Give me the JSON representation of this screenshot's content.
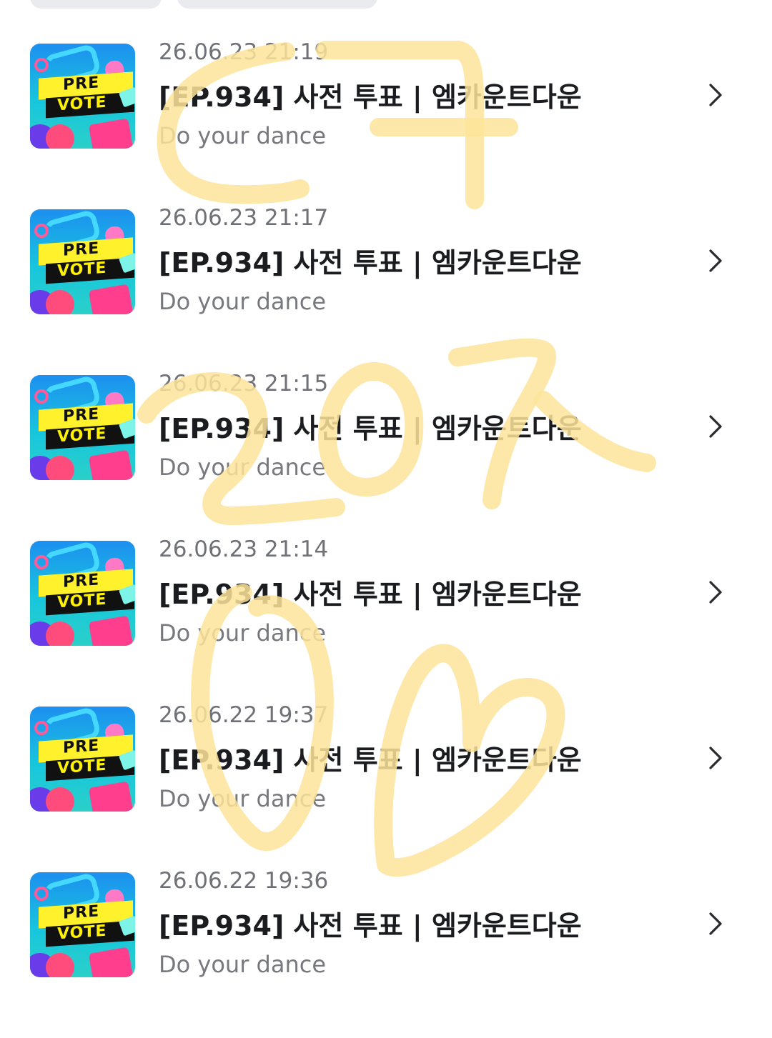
{
  "top_tabs": [
    "",
    ""
  ],
  "items": [
    {
      "date": "26.06.23 21:19",
      "title": "[EP.934] 사전 투표 | 엠카운트다운",
      "subtitle": "Do your dance"
    },
    {
      "date": "26.06.23 21:17",
      "title": "[EP.934] 사전 투표 | 엠카운트다운",
      "subtitle": "Do your dance"
    },
    {
      "date": "26.06.23 21:15",
      "title": "[EP.934] 사전 투표 | 엠카운트다운",
      "subtitle": "Do your dance"
    },
    {
      "date": "26.06.23 21:14",
      "title": "[EP.934] 사전 투표 | 엠카운트다운",
      "subtitle": "Do your dance"
    },
    {
      "date": "26.06.22 19:37",
      "title": "[EP.934] 사전 투표 | 엠카운트다운",
      "subtitle": "Do your dance"
    },
    {
      "date": "26.06.22 19:36",
      "title": "[EP.934] 사전 투표 | 엠카운트다운",
      "subtitle": "Do your dance"
    }
  ],
  "thumbnail": {
    "line1": "PRE",
    "line2": "VOTE"
  },
  "icons": {
    "row_arrow": "chevron-right-icon"
  },
  "overlay": {
    "drawing": "handwritten-scribble",
    "color": "#fde49a"
  }
}
